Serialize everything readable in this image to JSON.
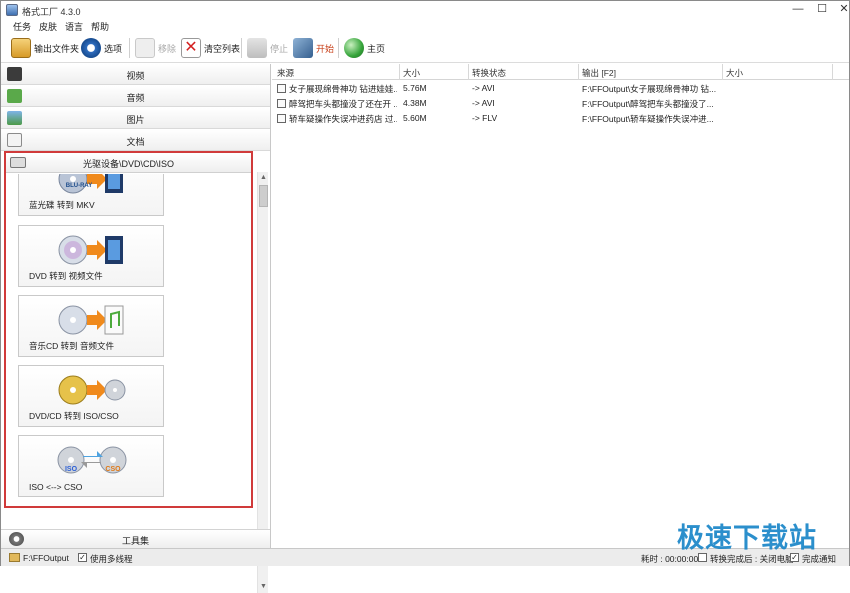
{
  "window": {
    "title": "格式工厂 4.3.0",
    "minimize": "—",
    "maximize": "☐",
    "close": "✕"
  },
  "menu": [
    "任务",
    "皮肤",
    "语言",
    "帮助"
  ],
  "toolbar": {
    "output_folder": "输出文件夹",
    "options": "选项",
    "remove": "移除",
    "clear_list": "清空列表",
    "stop": "停止",
    "start": "开始",
    "home": "主页"
  },
  "categories": [
    "视频",
    "音频",
    "图片",
    "文档"
  ],
  "dvd_section": {
    "title": "光驱设备\\DVD\\CD\\ISO",
    "items": [
      "蓝光碟 转到 MKV",
      "DVD 转到 视频文件",
      "音乐CD 转到 音频文件",
      "DVD/CD 转到 ISO/CSO",
      "ISO <--> CSO"
    ],
    "blu_ray_badge": "BLU-RAY",
    "iso_badge": "ISO",
    "cso_badge": "CSO"
  },
  "toolset_label": "工具集",
  "list": {
    "columns": [
      "来源",
      "大小",
      "转换状态",
      "输出 [F2]",
      "大小"
    ],
    "rows": [
      {
        "source": "女子展现绵骨神功 钻进娃娃...",
        "size": "5.76M",
        "status": "-> AVI",
        "output": "F:\\FFOutput\\女子展现绵骨神功 钻..."
      },
      {
        "source": "醉驾把车头都撞没了还在开 ...",
        "size": "4.38M",
        "status": "-> AVI",
        "output": "F:\\FFOutput\\醉驾把车头都撞没了..."
      },
      {
        "source": "轿车疑操作失误冲进药店 过...",
        "size": "5.60M",
        "status": "-> FLV",
        "output": "F:\\FFOutput\\轿车疑操作失误冲进..."
      }
    ]
  },
  "status": {
    "output_path": "F:\\FFOutput",
    "multithread": "使用多线程",
    "elapsed": "耗时 : 00:00:00",
    "after_convert": "转换完成后 : 关闭电脑",
    "notify": "完成通知",
    "multithread_checked": "✓",
    "notify_checked": "✓"
  },
  "watermark": "极速下载站"
}
